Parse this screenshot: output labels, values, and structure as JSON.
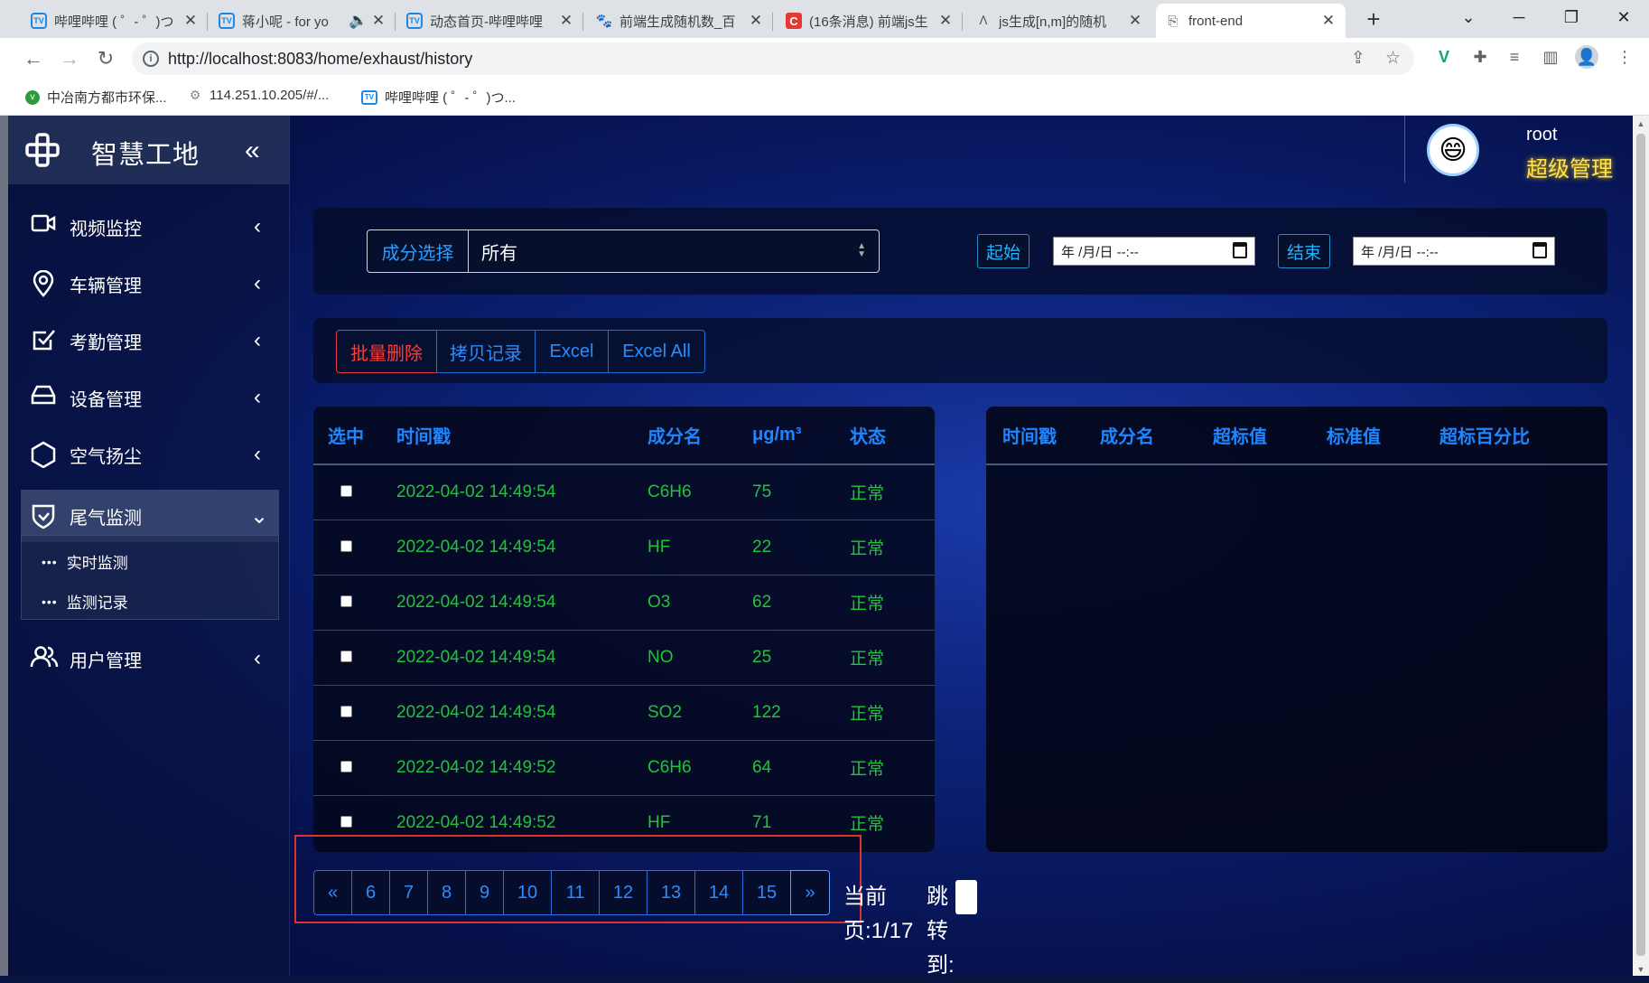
{
  "browser": {
    "tabs": [
      {
        "title": "哔哩哔哩 ( ゜- ゜)つ",
        "icon": "bilibili-icon"
      },
      {
        "title": "蒋小呢 - for yo",
        "icon": "bilibili-icon"
      },
      {
        "title": "动态首页-哔哩哔哩",
        "icon": "bilibili-icon"
      },
      {
        "title": "前端生成随机数_百",
        "icon": "baidu-icon"
      },
      {
        "title": "(16条消息) 前端js生",
        "icon": "csdn-icon"
      },
      {
        "title": "js生成[n,m]的随机",
        "icon": "bear-icon"
      },
      {
        "title": "front-end",
        "icon": "page-icon"
      }
    ],
    "url": "http://localhost:8083/home/exhaust/history",
    "bookmarks": [
      {
        "label": "中冶南方都市环保...",
        "icon": "v-icon"
      },
      {
        "label": "114.251.10.205/#/...",
        "icon": "gear-icon"
      },
      {
        "label": "哔哩哔哩 ( ゜- ゜)つ...",
        "icon": "bilibili-icon"
      }
    ]
  },
  "sidebar": {
    "brand": "智慧工地",
    "menu": [
      {
        "label": "视频监控",
        "icon": "video-camera-icon"
      },
      {
        "label": "车辆管理",
        "icon": "location-pin-icon"
      },
      {
        "label": "考勤管理",
        "icon": "checkbox-icon"
      },
      {
        "label": "设备管理",
        "icon": "hard-drive-icon"
      },
      {
        "label": "空气扬尘",
        "icon": "hexagon-icon"
      },
      {
        "label": "尾气监测",
        "icon": "shield-check-icon"
      },
      {
        "label": "用户管理",
        "icon": "users-icon"
      }
    ],
    "submenu": [
      "实时监测",
      "监测记录"
    ]
  },
  "user": {
    "name": "root",
    "role": "超级管理"
  },
  "filters": {
    "component_label": "成分选择",
    "component_value": "所有",
    "start_label": "起始",
    "end_label": "结束",
    "start_value": "年 /月/日 --:--",
    "end_value": "年 /月/日 --:--"
  },
  "actions": {
    "batch_delete": "批量删除",
    "copy_records": "拷贝记录",
    "excel": "Excel",
    "excel_all": "Excel All"
  },
  "table": {
    "headers": [
      "选中",
      "时间戳",
      "成分名",
      "μg/m³",
      "状态"
    ],
    "rows": [
      {
        "time": "2022-04-02 14:49:54",
        "name": "C6H6",
        "value": "75",
        "status": "正常"
      },
      {
        "time": "2022-04-02 14:49:54",
        "name": "HF",
        "value": "22",
        "status": "正常"
      },
      {
        "time": "2022-04-02 14:49:54",
        "name": "O3",
        "value": "62",
        "status": "正常"
      },
      {
        "time": "2022-04-02 14:49:54",
        "name": "NO",
        "value": "25",
        "status": "正常"
      },
      {
        "time": "2022-04-02 14:49:54",
        "name": "SO2",
        "value": "122",
        "status": "正常"
      },
      {
        "time": "2022-04-02 14:49:52",
        "name": "C6H6",
        "value": "64",
        "status": "正常"
      },
      {
        "time": "2022-04-02 14:49:52",
        "name": "HF",
        "value": "71",
        "status": "正常"
      }
    ]
  },
  "exceed_table": {
    "headers": [
      "时间戳",
      "成分名",
      "超标值",
      "标准值",
      "超标百分比"
    ]
  },
  "pagination": {
    "prev": "«",
    "pages": [
      "6",
      "7",
      "8",
      "9",
      "10",
      "11",
      "12",
      "13",
      "14",
      "15"
    ],
    "next": "»",
    "current": "当前页:1/17",
    "jump": "跳转到:"
  },
  "colors": {
    "accent": "#1e86ff",
    "normal": "#21c33a",
    "danger": "#ff3b3b",
    "role": "#ffe34d"
  }
}
